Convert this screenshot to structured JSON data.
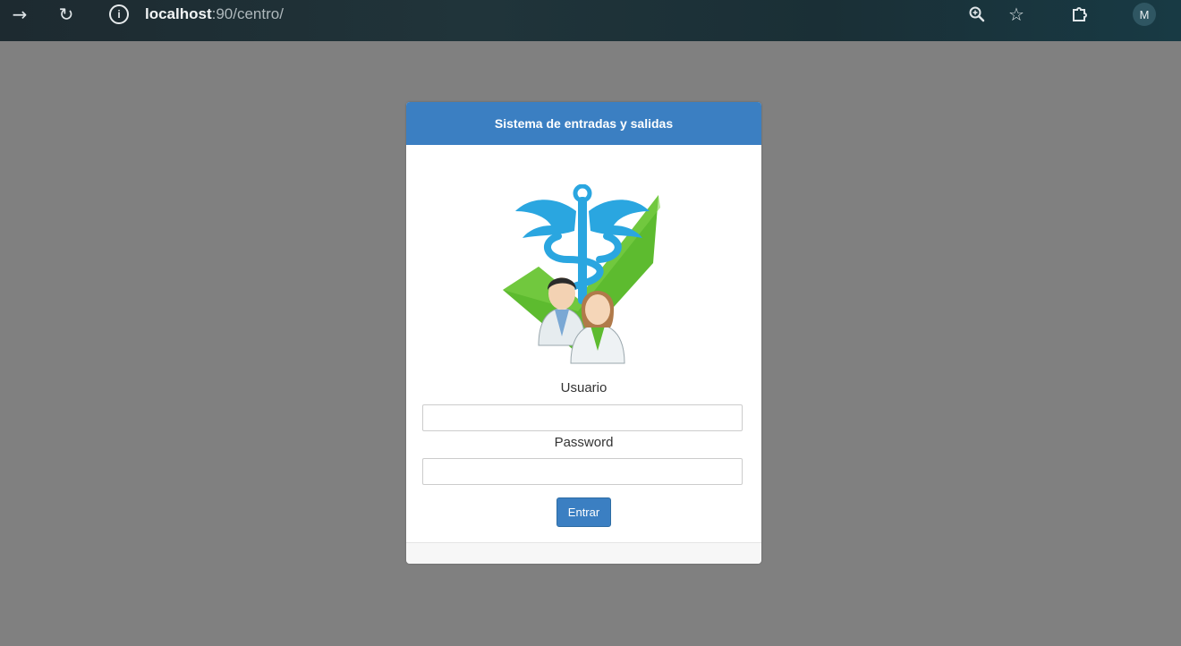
{
  "browser": {
    "url_host": "localhost",
    "url_rest": ":90/centro/",
    "profile_initial": "M",
    "icons": [
      "forward-icon",
      "reload-icon",
      "site-info-icon",
      "zoom-icon",
      "bookmark-star-icon",
      "extensions-icon"
    ]
  },
  "login": {
    "header_title": "Sistema de entradas y salidas",
    "username_label": "Usuario",
    "username_value": "",
    "password_label": "Password",
    "password_value": "",
    "submit_label": "Entrar"
  },
  "colors": {
    "page_background": "#808080",
    "accent": "#3b7fc2",
    "logo_blue": "#2aa6e0",
    "logo_green": "#5dbb2f"
  }
}
